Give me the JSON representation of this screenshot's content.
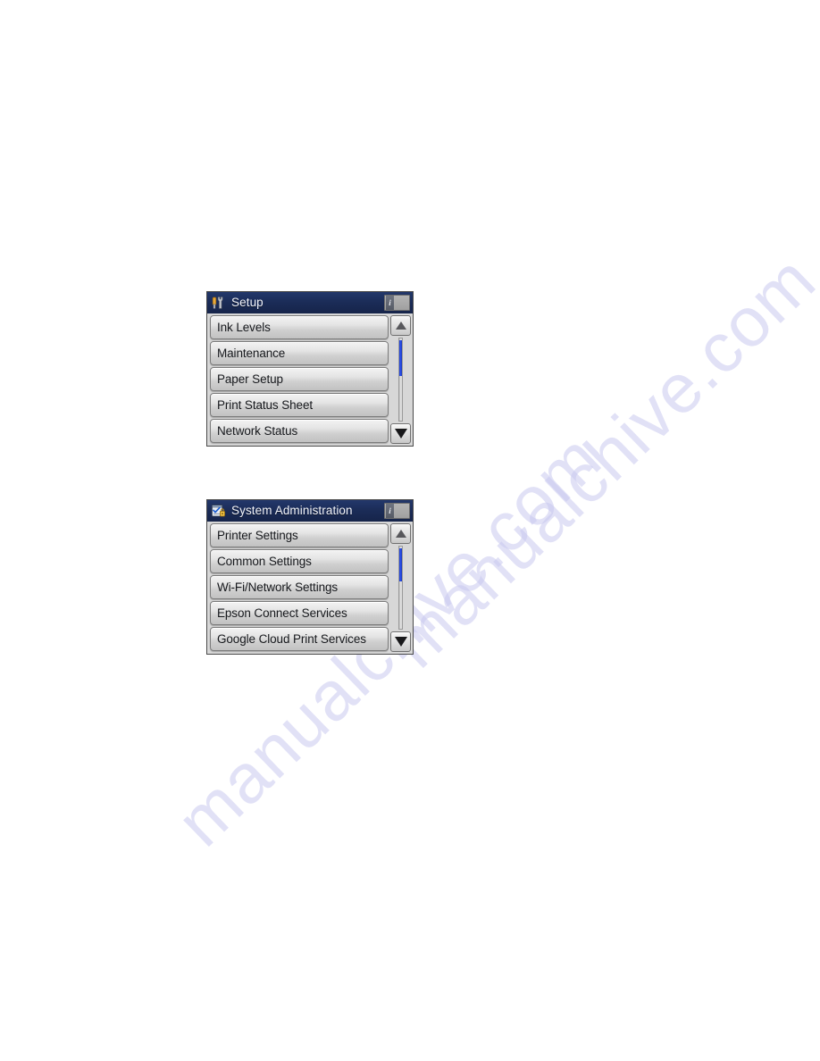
{
  "page": {
    "background_color": "#ffffff",
    "watermark_text": "manualchive.com",
    "watermark_color": "#c9c9ef"
  },
  "panels": [
    {
      "id": "setup",
      "title": "Setup",
      "title_icon": "tools-icon",
      "titlebar_color": "#1b2c57",
      "help_button": {
        "name": "info-button",
        "glyph": "i"
      },
      "items": [
        {
          "label": "Ink Levels"
        },
        {
          "label": "Maintenance"
        },
        {
          "label": "Paper Setup"
        },
        {
          "label": "Print Status Sheet"
        },
        {
          "label": "Network Status"
        }
      ],
      "scrollbar": {
        "up_arrow": "scroll-up-arrow",
        "down_arrow": "scroll-down-arrow",
        "thumb_color": "#2d53ec",
        "thumb_top_pct": 2,
        "thumb_height_pct": 44
      }
    },
    {
      "id": "system-administration",
      "title": "System Administration",
      "title_icon": "settings-lock-icon",
      "titlebar_color": "#1b2c57",
      "help_button": {
        "name": "info-button",
        "glyph": "i"
      },
      "items": [
        {
          "label": "Printer Settings"
        },
        {
          "label": "Common Settings"
        },
        {
          "label": "Wi-Fi/Network Settings"
        },
        {
          "label": "Epson Connect Services"
        },
        {
          "label": "Google Cloud Print Services"
        }
      ],
      "scrollbar": {
        "up_arrow": "scroll-up-arrow",
        "down_arrow": "scroll-down-arrow",
        "thumb_color": "#2d53ec",
        "thumb_top_pct": 2,
        "thumb_height_pct": 40
      }
    }
  ]
}
